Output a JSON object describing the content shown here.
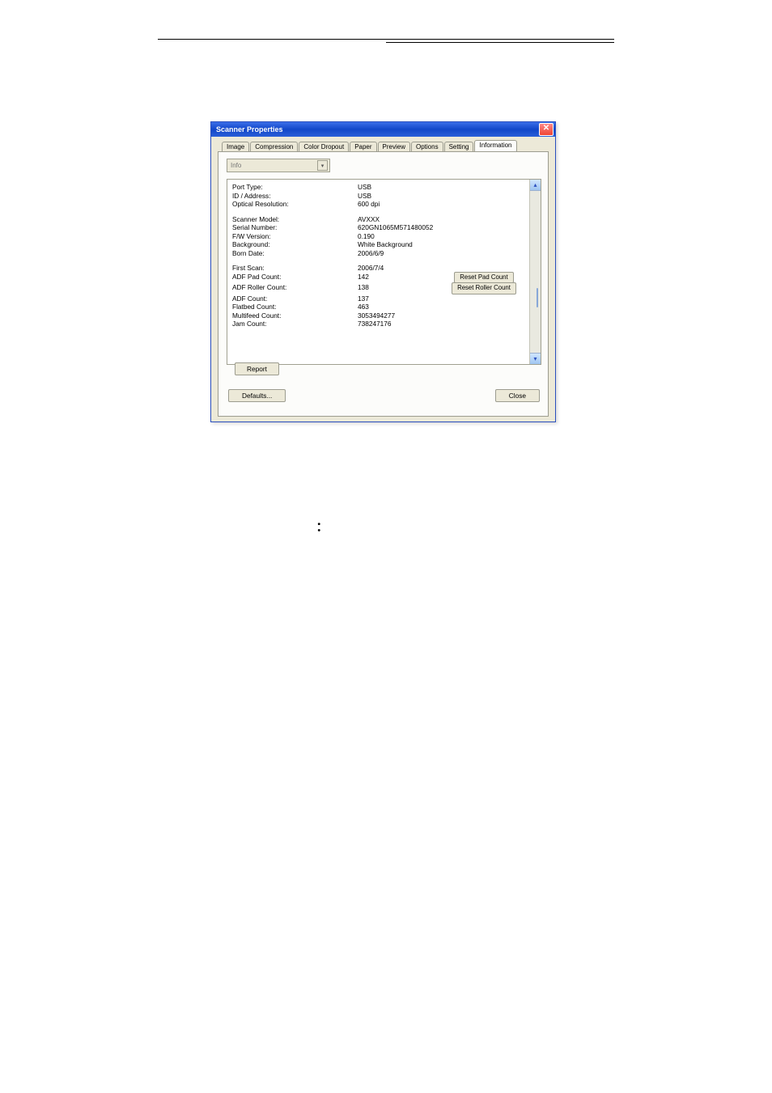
{
  "dialog": {
    "title": "Scanner Properties",
    "close_glyph": "✕",
    "tabs": [
      "Image",
      "Compression",
      "Color Dropout",
      "Paper",
      "Preview",
      "Options",
      "Setting",
      "Information"
    ],
    "active_tab_index": 7,
    "info_select_label": "Info",
    "chev_glyph": "▾",
    "block1": [
      {
        "k": "Port Type:",
        "v": "USB"
      },
      {
        "k": "ID / Address:",
        "v": "USB"
      },
      {
        "k": "Optical Resolution:",
        "v": "600 dpi"
      }
    ],
    "block2": [
      {
        "k": "Scanner Model:",
        "v": "AVXXX"
      },
      {
        "k": "Serial Number:",
        "v": "620GN1065M571480052"
      },
      {
        "k": "F/W Version:",
        "v": "0.190"
      },
      {
        "k": "Background:",
        "v": "White Background"
      },
      {
        "k": "Born Date:",
        "v": "2006/6/9"
      }
    ],
    "block3": [
      {
        "k": "First Scan:",
        "v": "2006/7/4",
        "btn": ""
      },
      {
        "k": "ADF Pad Count:",
        "v": "142",
        "btn": "Reset Pad Count"
      },
      {
        "k": "ADF Roller Count:",
        "v": "138",
        "btn": "Reset Roller Count"
      },
      {
        "k": "ADF Count:",
        "v": "137",
        "btn": ""
      },
      {
        "k": "Flatbed Count:",
        "v": "463",
        "btn": ""
      },
      {
        "k": "Multifeed Count:",
        "v": "3053494277",
        "btn": ""
      },
      {
        "k": "Jam Count:",
        "v": "738247176",
        "btn": ""
      }
    ],
    "report_btn": "Report",
    "defaults_btn": "Defaults...",
    "close_footer_btn": "Close"
  },
  "caption_glyph": "："
}
